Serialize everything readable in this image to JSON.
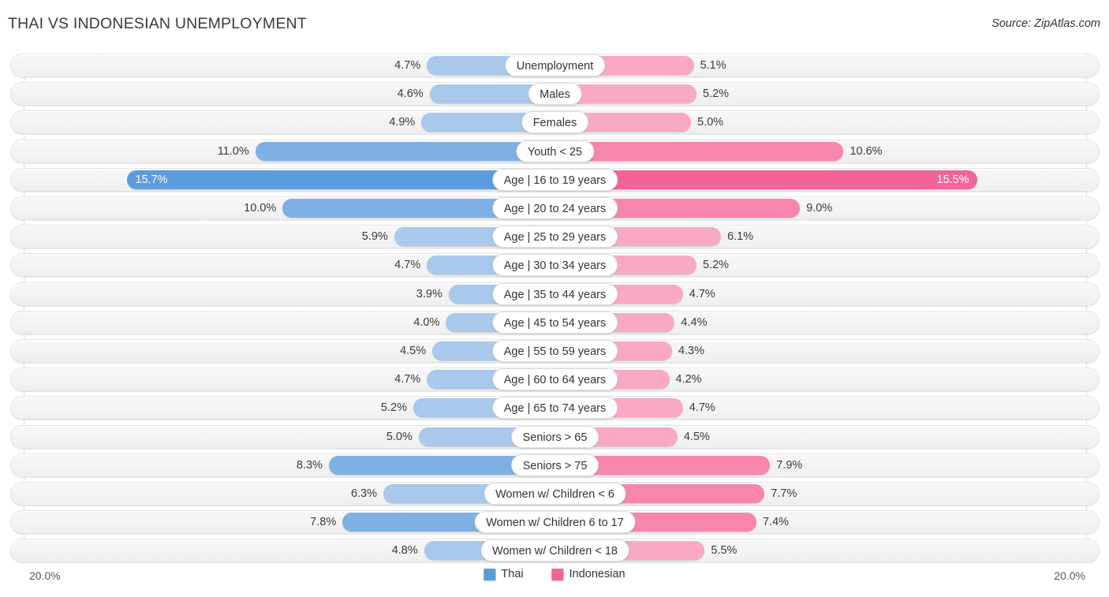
{
  "header": {
    "title": "THAI VS INDONESIAN UNEMPLOYMENT",
    "source": "Source: ZipAtlas.com"
  },
  "axis": {
    "left_label": "20.0%",
    "right_label": "20.0%",
    "max": 20.0
  },
  "legend": {
    "items": [
      {
        "label": "Thai",
        "color": "#5b9bd5"
      },
      {
        "label": "Indonesian",
        "color": "#f2649a"
      }
    ]
  },
  "colors": {
    "thai_light": "#a8c8ec",
    "thai_mid": "#7fb0e4",
    "thai_dark": "#5d9cdc",
    "indonesian_light": "#f9a9c5",
    "indonesian_mid": "#f785ad",
    "indonesian_dark": "#f2649a",
    "track": "#f4f4f4",
    "gridline": "#dddddd"
  },
  "chart_data": {
    "type": "bar",
    "orientation": "horizontal-diverging",
    "title": "THAI VS INDONESIAN UNEMPLOYMENT",
    "xlabel": "",
    "ylabel": "",
    "xlim": [
      20.0,
      20.0
    ],
    "grid": true,
    "legend_position": "bottom-center",
    "categories": [
      "Unemployment",
      "Males",
      "Females",
      "Youth < 25",
      "Age | 16 to 19 years",
      "Age | 20 to 24 years",
      "Age | 25 to 29 years",
      "Age | 30 to 34 years",
      "Age | 35 to 44 years",
      "Age | 45 to 54 years",
      "Age | 55 to 59 years",
      "Age | 60 to 64 years",
      "Age | 65 to 74 years",
      "Seniors > 65",
      "Seniors > 75",
      "Women w/ Children < 6",
      "Women w/ Children 6 to 17",
      "Women w/ Children < 18"
    ],
    "series": [
      {
        "name": "Thai",
        "color": "#5b9bd5",
        "values": [
          4.7,
          4.6,
          4.9,
          11.0,
          15.7,
          10.0,
          5.9,
          4.7,
          3.9,
          4.0,
          4.5,
          4.7,
          5.2,
          5.0,
          8.3,
          6.3,
          7.8,
          4.8
        ],
        "labels": [
          "4.7%",
          "4.6%",
          "4.9%",
          "11.0%",
          "15.7%",
          "10.0%",
          "5.9%",
          "4.7%",
          "3.9%",
          "4.0%",
          "4.5%",
          "4.7%",
          "5.2%",
          "5.0%",
          "8.3%",
          "6.3%",
          "7.8%",
          "4.8%"
        ]
      },
      {
        "name": "Indonesian",
        "color": "#f2649a",
        "values": [
          5.1,
          5.2,
          5.0,
          10.6,
          15.5,
          9.0,
          6.1,
          5.2,
          4.7,
          4.4,
          4.3,
          4.2,
          4.7,
          4.5,
          7.9,
          7.7,
          7.4,
          5.5
        ],
        "labels": [
          "5.1%",
          "5.2%",
          "5.0%",
          "10.6%",
          "15.5%",
          "9.0%",
          "6.1%",
          "5.2%",
          "4.7%",
          "4.4%",
          "4.3%",
          "4.2%",
          "4.7%",
          "4.5%",
          "7.9%",
          "7.7%",
          "7.4%",
          "5.5%"
        ]
      }
    ]
  }
}
